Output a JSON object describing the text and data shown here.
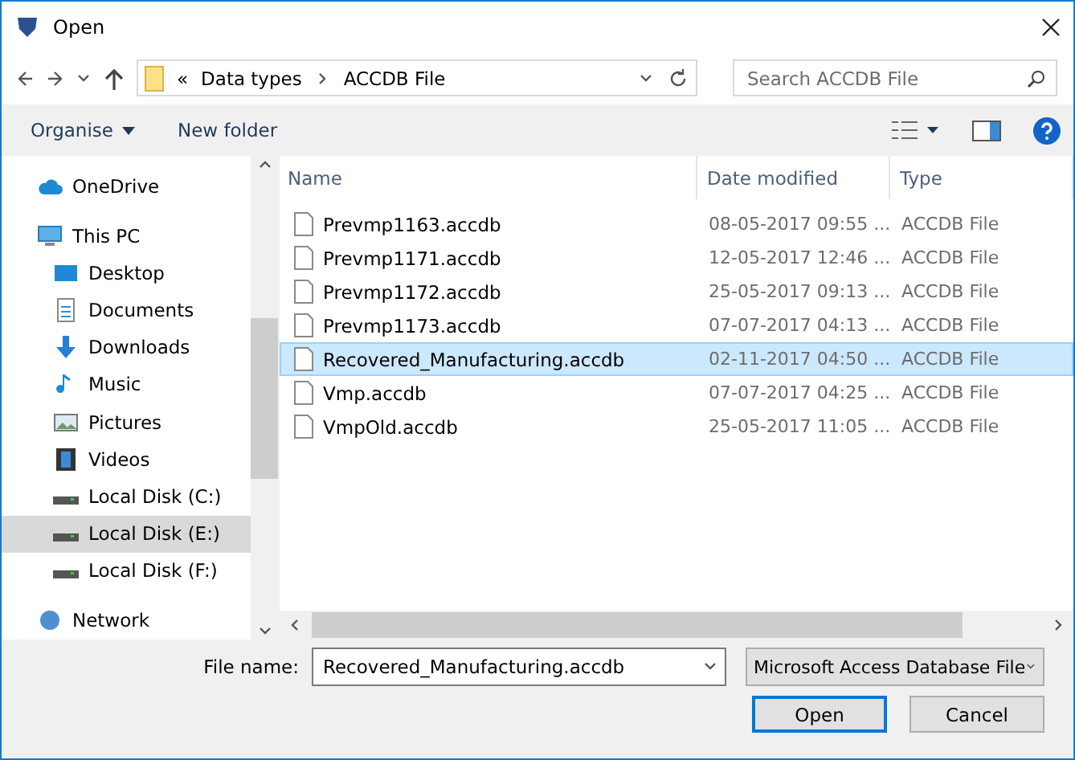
{
  "window": {
    "title": "Open"
  },
  "address": {
    "overflow": "«",
    "crumbs": [
      "Data types",
      "ACCDB File"
    ]
  },
  "search": {
    "placeholder": "Search ACCDB File"
  },
  "toolbar": {
    "organise": "Organise",
    "new_folder": "New folder"
  },
  "sidebar": {
    "items": [
      {
        "label": "OneDrive",
        "kind": "cloud",
        "selected": false
      },
      {
        "label": "This PC",
        "kind": "pc",
        "selected": false,
        "children": [
          {
            "label": "Desktop",
            "kind": "desktop",
            "selected": false
          },
          {
            "label": "Documents",
            "kind": "documents",
            "selected": false
          },
          {
            "label": "Downloads",
            "kind": "downloads",
            "selected": false
          },
          {
            "label": "Music",
            "kind": "music",
            "selected": false
          },
          {
            "label": "Pictures",
            "kind": "pictures",
            "selected": false
          },
          {
            "label": "Videos",
            "kind": "videos",
            "selected": false
          },
          {
            "label": "Local Disk (C:)",
            "kind": "disk",
            "selected": false
          },
          {
            "label": "Local Disk (E:)",
            "kind": "disk",
            "selected": true
          },
          {
            "label": "Local Disk (F:)",
            "kind": "disk",
            "selected": false
          }
        ]
      },
      {
        "label": "Network",
        "kind": "network",
        "selected": false
      }
    ]
  },
  "table": {
    "columns": [
      "Name",
      "Date modified",
      "Type"
    ],
    "rows": [
      {
        "name": "Prevmp1163.accdb",
        "date": "08-05-2017 09:55 ...",
        "type": "ACCDB File",
        "selected": false
      },
      {
        "name": "Prevmp1171.accdb",
        "date": "12-05-2017 12:46 ...",
        "type": "ACCDB File",
        "selected": false
      },
      {
        "name": "Prevmp1172.accdb",
        "date": "25-05-2017 09:13 ...",
        "type": "ACCDB File",
        "selected": false
      },
      {
        "name": "Prevmp1173.accdb",
        "date": "07-07-2017 04:13 ...",
        "type": "ACCDB File",
        "selected": false
      },
      {
        "name": "Recovered_Manufacturing.accdb",
        "date": "02-11-2017 04:50 ...",
        "type": "ACCDB File",
        "selected": true
      },
      {
        "name": "Vmp.accdb",
        "date": "07-07-2017 04:25 ...",
        "type": "ACCDB File",
        "selected": false
      },
      {
        "name": "VmpOld.accdb",
        "date": "25-05-2017 11:05 ...",
        "type": "ACCDB File",
        "selected": false
      }
    ]
  },
  "file_name": {
    "label": "File name:",
    "value": "Recovered_Manufacturing.accdb"
  },
  "file_type": {
    "value": "Microsoft Access Database File"
  },
  "buttons": [
    {
      "label": "Open",
      "default": true
    },
    {
      "label": "Cancel",
      "default": false
    }
  ]
}
